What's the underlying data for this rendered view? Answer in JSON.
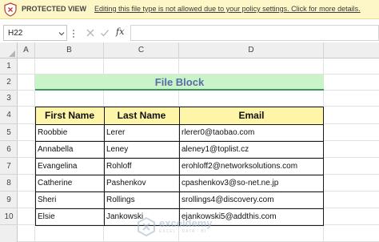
{
  "protected_view": {
    "title": "PROTECTED VIEW",
    "message": "Editing this file type is not allowed due to your policy settings. Click for more details."
  },
  "formula_bar": {
    "name_box": "H22",
    "fx_label": "fx",
    "formula": ""
  },
  "columns": [
    "A",
    "B",
    "C",
    "D"
  ],
  "rows": [
    "1",
    "2",
    "3",
    "4",
    "5",
    "6",
    "7",
    "8",
    "9",
    "10"
  ],
  "sheet": {
    "title": "File Block",
    "headers": [
      "First Name",
      "Last Name",
      "Email"
    ],
    "records": [
      [
        "Roobbie",
        "Lerer",
        "rlerer0@taobao.com"
      ],
      [
        "Annabella",
        "Leney",
        "aleney1@toplist.cz"
      ],
      [
        "Evangelina",
        "Rohloff",
        "erohloff2@networksolutions.com"
      ],
      [
        "Catherine",
        "Pashenkov",
        "cpashenkov3@so-net.ne.jp"
      ],
      [
        "Sheri",
        "Rollings",
        "srollings4@discovery.com"
      ],
      [
        "Elsie",
        "Jankowski",
        "ejankowski5@addthis.com"
      ]
    ]
  },
  "watermark": {
    "name": "exceldemy",
    "tagline": "EXCEL · DATA · BI"
  },
  "colors": {
    "protected_bar": "#fdf6c6",
    "title_fill": "#c9f4c9",
    "title_text": "#5a6ca6",
    "header_fill": "#fff5a8"
  }
}
